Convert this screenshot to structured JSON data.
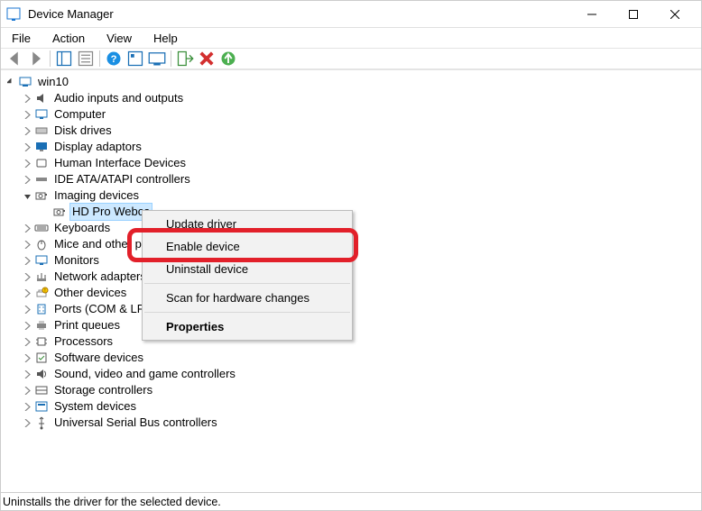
{
  "window": {
    "title": "Device Manager",
    "minimize_tooltip": "Minimize",
    "maximize_tooltip": "Maximize",
    "close_tooltip": "Close"
  },
  "menubar": {
    "file": "File",
    "action": "Action",
    "view": "View",
    "help": "Help"
  },
  "toolbar": {
    "back": "Back",
    "forward": "Forward",
    "show_hide": "Show/Hide Console Tree",
    "properties": "Properties",
    "help": "Help",
    "action_center": "Action Center",
    "update_driver": "Update device drivers",
    "enable": "Enable device",
    "uninstall": "Uninstall device",
    "scan": "Scan for hardware changes"
  },
  "tree": {
    "root": "win10",
    "nodes": [
      {
        "label": "Audio inputs and outputs",
        "icon": "speaker"
      },
      {
        "label": "Computer",
        "icon": "monitor"
      },
      {
        "label": "Disk drives",
        "icon": "disk"
      },
      {
        "label": "Display adaptors",
        "icon": "display"
      },
      {
        "label": "Human Interface Devices",
        "icon": "hid"
      },
      {
        "label": "IDE ATA/ATAPI controllers",
        "icon": "ide"
      },
      {
        "label": "Imaging devices",
        "icon": "camera",
        "expanded": true
      },
      {
        "label": "Keyboards",
        "icon": "keyboard"
      },
      {
        "label": "Mice and other pointing devices",
        "icon": "mouse",
        "truncated": "Mice and other po"
      },
      {
        "label": "Monitors",
        "icon": "monitor"
      },
      {
        "label": "Network adapters",
        "icon": "network"
      },
      {
        "label": "Other devices",
        "icon": "other"
      },
      {
        "label": "Ports (COM & LPT)",
        "icon": "port",
        "truncated": "Ports (COM & LPT"
      },
      {
        "label": "Print queues",
        "icon": "printer"
      },
      {
        "label": "Processors",
        "icon": "cpu"
      },
      {
        "label": "Software devices",
        "icon": "software"
      },
      {
        "label": "Sound, video and game controllers",
        "icon": "sound"
      },
      {
        "label": "Storage controllers",
        "icon": "storage"
      },
      {
        "label": "System devices",
        "icon": "system"
      },
      {
        "label": "Universal Serial Bus controllers",
        "icon": "usb"
      }
    ],
    "selected_child": "HD Pro Webca"
  },
  "context_menu": {
    "update_driver": "Update driver",
    "enable_device": "Enable device",
    "uninstall_device": "Uninstall device",
    "scan_changes": "Scan for hardware changes",
    "properties": "Properties"
  },
  "statusbar": {
    "text": "Uninstalls the driver for the selected device."
  }
}
